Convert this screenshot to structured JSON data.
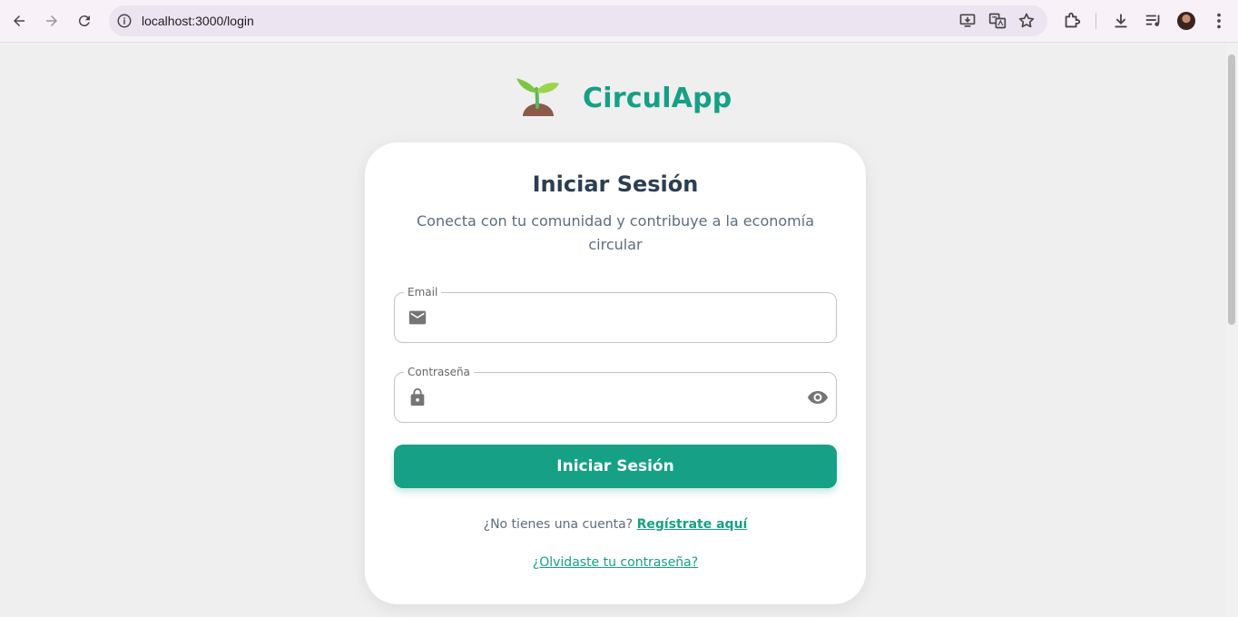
{
  "browser": {
    "url": "localhost:3000/login"
  },
  "brand": {
    "name": "CirculApp",
    "primary_color": "#16a085"
  },
  "login": {
    "title": "Iniciar Sesión",
    "subtitle": "Conecta con tu comunidad y contribuye a la economía circular",
    "email": {
      "label": "Email",
      "value": "",
      "icon": "mail-icon"
    },
    "password": {
      "label": "Contraseña",
      "value": "",
      "icon": "lock-icon",
      "toggle_icon": "eye-icon"
    },
    "submit_label": "Iniciar Sesión",
    "signup_prompt": "¿No tienes una cuenta?",
    "signup_link": "Regístrate aquí",
    "forgot_link": "¿Olvidaste tu contraseña?"
  }
}
